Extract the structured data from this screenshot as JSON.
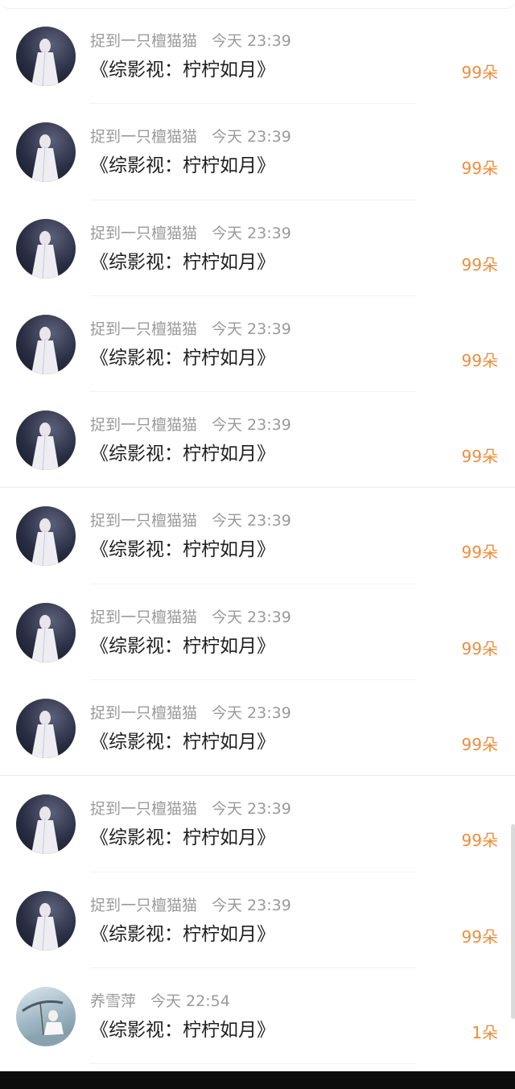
{
  "list": {
    "items": [
      {
        "user": "捉到一只檀猫猫",
        "time": "今天 23:39",
        "title": "《综影视：柠柠如月》",
        "flowers": "99朵"
      },
      {
        "user": "捉到一只檀猫猫",
        "time": "今天 23:39",
        "title": "《综影视：柠柠如月》",
        "flowers": "99朵"
      },
      {
        "user": "捉到一只檀猫猫",
        "time": "今天 23:39",
        "title": "《综影视：柠柠如月》",
        "flowers": "99朵"
      },
      {
        "user": "捉到一只檀猫猫",
        "time": "今天 23:39",
        "title": "《综影视：柠柠如月》",
        "flowers": "99朵"
      },
      {
        "user": "捉到一只檀猫猫",
        "time": "今天 23:39",
        "title": "《综影视：柠柠如月》",
        "flowers": "99朵"
      },
      {
        "user": "捉到一只檀猫猫",
        "time": "今天 23:39",
        "title": "《综影视：柠柠如月》",
        "flowers": "99朵"
      },
      {
        "user": "捉到一只檀猫猫",
        "time": "今天 23:39",
        "title": "《综影视：柠柠如月》",
        "flowers": "99朵"
      },
      {
        "user": "捉到一只檀猫猫",
        "time": "今天 23:39",
        "title": "《综影视：柠柠如月》",
        "flowers": "99朵"
      },
      {
        "user": "捉到一只檀猫猫",
        "time": "今天 23:39",
        "title": "《综影视：柠柠如月》",
        "flowers": "99朵"
      },
      {
        "user": "捉到一只檀猫猫",
        "time": "今天 23:39",
        "title": "《综影视：柠柠如月》",
        "flowers": "99朵"
      },
      {
        "user": "养雪萍",
        "time": "今天 22:54",
        "title": "《综影视：柠柠如月》",
        "flowers": "1朵"
      }
    ]
  },
  "colors": {
    "flowers": "#f08c3b",
    "meta": "#9a9a9a",
    "title": "#1f1f1f"
  }
}
